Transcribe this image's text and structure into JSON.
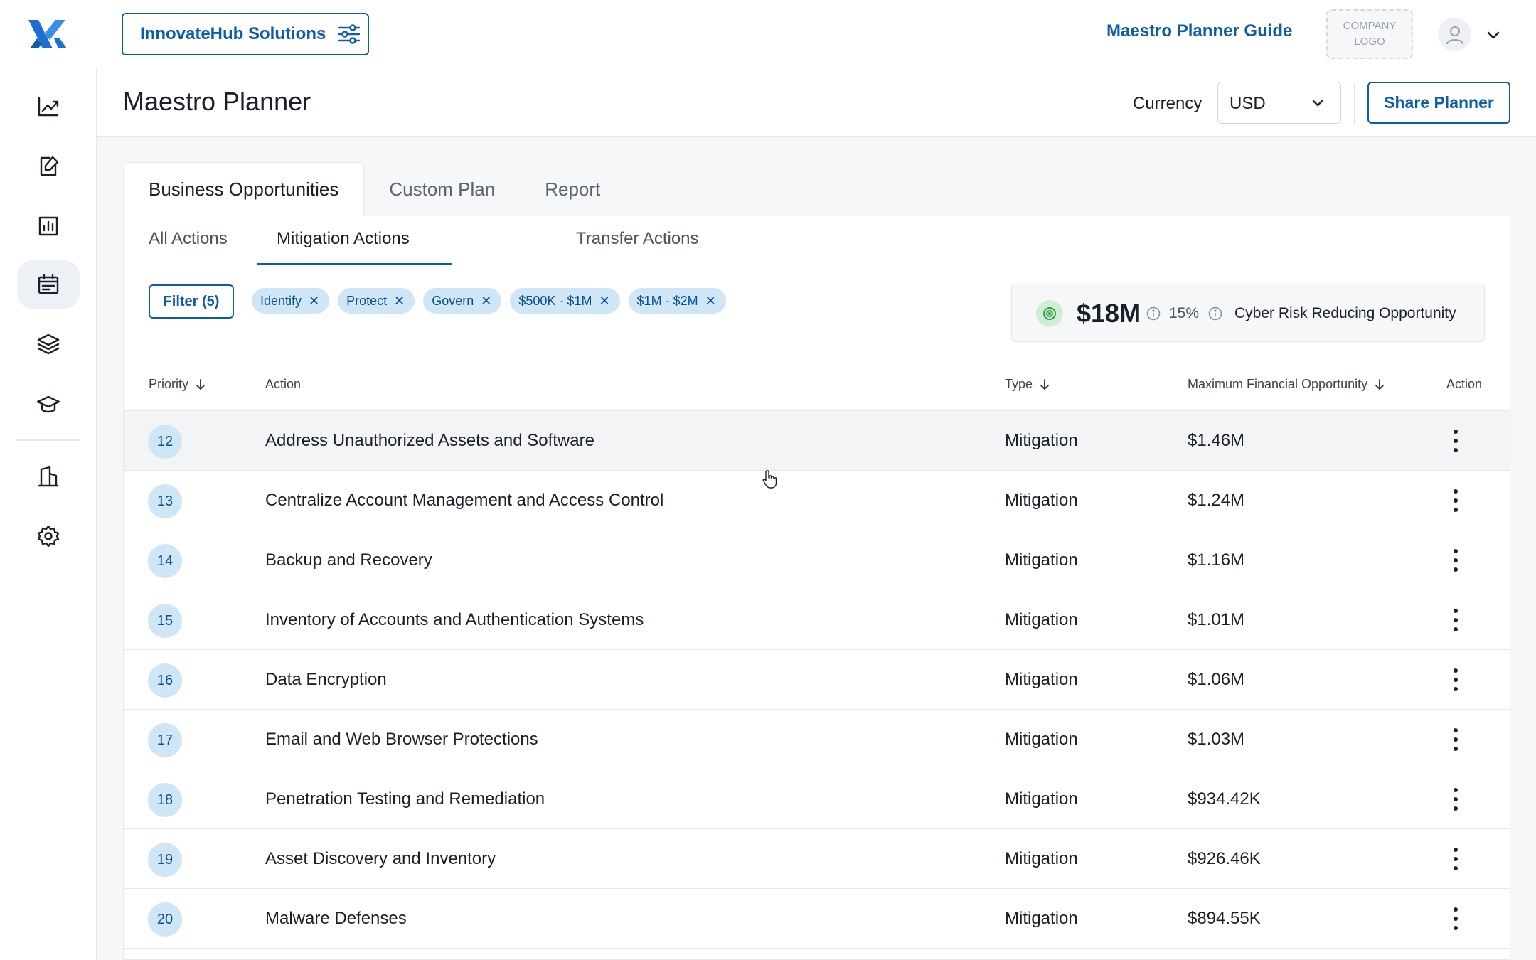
{
  "topbar": {
    "org_name": "InnovateHub Solutions",
    "guide_link": "Maestro Planner Guide",
    "company_logo": [
      "COMPANY",
      "LOGO"
    ]
  },
  "colors": {
    "brand": "#0b5cab",
    "chip_bg": "#cfe6f7",
    "chip_text": "#0b4f8a",
    "opportunity_icon_bg": "#cfeed5",
    "opportunity_icon": "#2e9b4a"
  },
  "sidebar": {
    "items": [
      {
        "icon": "trend-chart-icon",
        "active": false
      },
      {
        "icon": "edit-document-icon",
        "active": false
      },
      {
        "icon": "report-chart-icon",
        "active": false
      },
      {
        "icon": "calendar-icon",
        "active": true
      },
      {
        "icon": "layers-icon",
        "active": false
      },
      {
        "icon": "graduation-cap-icon",
        "active": false
      },
      {
        "icon": "building-icon",
        "active": false
      },
      {
        "icon": "gear-icon",
        "active": false
      }
    ]
  },
  "header": {
    "title": "Maestro Planner",
    "currency_label": "Currency",
    "currency_value": "USD",
    "share_label": "Share Planner"
  },
  "tabs": [
    {
      "label": "Business Opportunities",
      "active": true
    },
    {
      "label": "Custom Plan",
      "active": false
    },
    {
      "label": "Report",
      "active": false
    }
  ],
  "subtabs": [
    {
      "label": "All Actions",
      "active": false
    },
    {
      "label": "Mitigation Actions",
      "active": true
    },
    {
      "label": "Transfer Actions",
      "active": false
    }
  ],
  "filter": {
    "button_label": "Filter (5)",
    "chips": [
      "Identify",
      "Protect",
      "Govern",
      "$500K - $1M",
      "$1M - $2M"
    ]
  },
  "summary": {
    "amount": "$18M",
    "percent": "15%",
    "label": "Cyber Risk Reducing Opportunity"
  },
  "table": {
    "columns": {
      "priority": "Priority",
      "action": "Action",
      "type": "Type",
      "max_opportunity": "Maximum Financial Opportunity",
      "actions": "Action"
    },
    "rows": [
      {
        "priority": "12",
        "action": "Address Unauthorized Assets and Software",
        "type": "Mitigation",
        "amount": "$1.46M"
      },
      {
        "priority": "13",
        "action": "Centralize Account Management and Access Control",
        "type": "Mitigation",
        "amount": "$1.24M"
      },
      {
        "priority": "14",
        "action": "Backup and Recovery",
        "type": "Mitigation",
        "amount": "$1.16M"
      },
      {
        "priority": "15",
        "action": "Inventory of Accounts and Authentication Systems",
        "type": "Mitigation",
        "amount": "$1.01M"
      },
      {
        "priority": "16",
        "action": "Data Encryption",
        "type": "Mitigation",
        "amount": "$1.06M"
      },
      {
        "priority": "17",
        "action": "Email and Web Browser Protections",
        "type": "Mitigation",
        "amount": "$1.03M"
      },
      {
        "priority": "18",
        "action": "Penetration Testing and Remediation",
        "type": "Mitigation",
        "amount": "$934.42K"
      },
      {
        "priority": "19",
        "action": "Asset Discovery and Inventory",
        "type": "Mitigation",
        "amount": "$926.46K"
      },
      {
        "priority": "20",
        "action": "Malware Defenses",
        "type": "Mitigation",
        "amount": "$894.55K"
      }
    ]
  }
}
